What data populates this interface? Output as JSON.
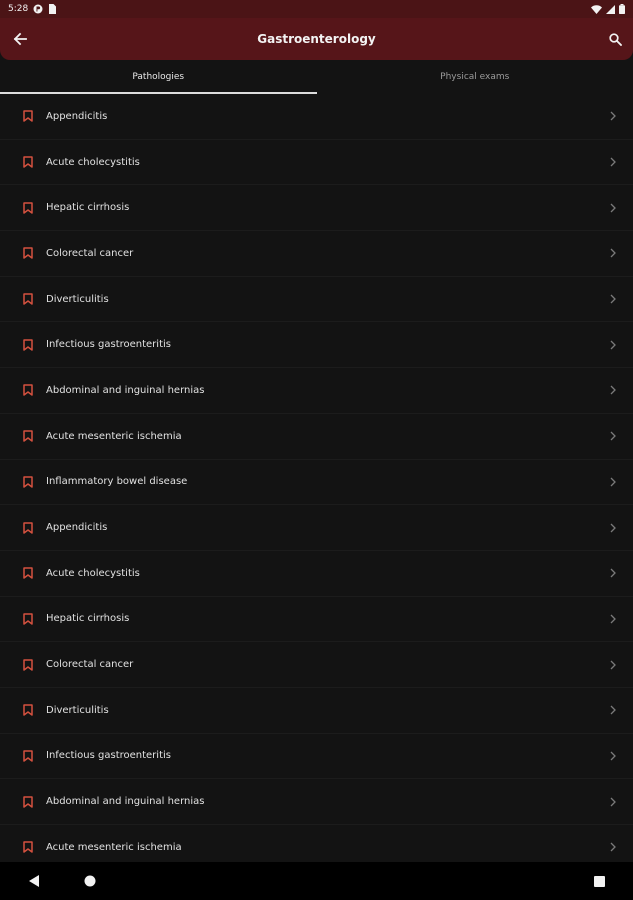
{
  "status_bar": {
    "time": "5:28"
  },
  "app_bar": {
    "title": "Gastroenterology"
  },
  "tabs": [
    {
      "label": "Pathologies",
      "active": true
    },
    {
      "label": "Physical exams",
      "active": false
    }
  ],
  "list": {
    "items": [
      "Appendicitis",
      "Acute cholecystitis",
      "Hepatic cirrhosis",
      "Colorectal cancer",
      "Diverticulitis",
      "Infectious gastroenteritis",
      "Abdominal and inguinal hernias",
      "Acute mesenteric ischemia",
      "Inflammatory bowel disease",
      "Appendicitis",
      "Acute cholecystitis",
      "Hepatic cirrhosis",
      "Colorectal cancer",
      "Diverticulitis",
      "Infectious gastroenteritis",
      "Abdominal and inguinal hernias",
      "Acute mesenteric ischemia"
    ]
  },
  "icons": {
    "back": "arrow-left-icon",
    "search": "search-icon",
    "bookmark": "bookmark-icon",
    "chevron": "chevron-right-icon"
  },
  "colors": {
    "app_bar": "#561519",
    "status_bar": "#4b1416",
    "bookmark": "#d4513f",
    "background": "#131313"
  }
}
